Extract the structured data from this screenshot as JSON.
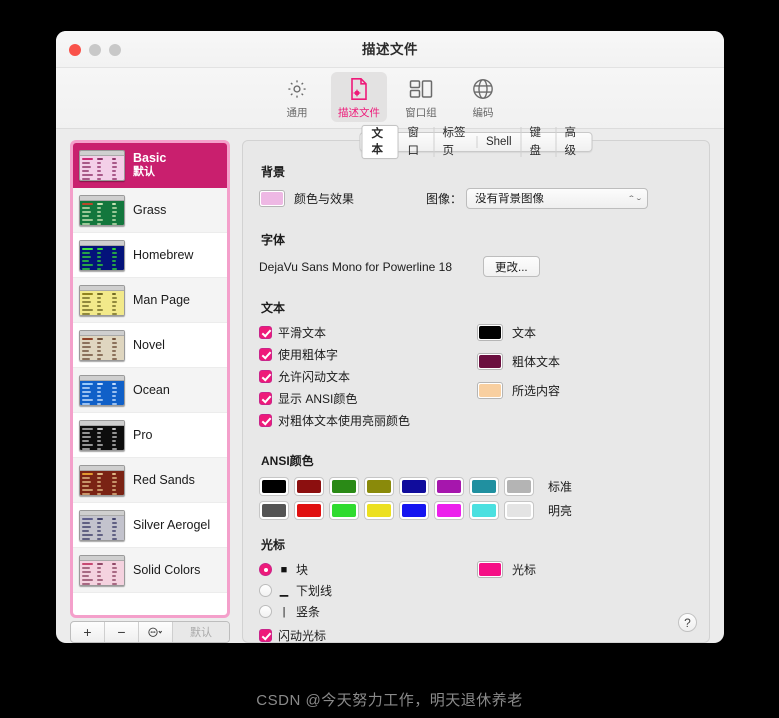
{
  "window": {
    "title": "描述文件"
  },
  "toolbar": {
    "items": [
      {
        "label": "通用",
        "icon": "gear-icon",
        "active": false
      },
      {
        "label": "描述文件",
        "icon": "profile-document-icon",
        "active": true
      },
      {
        "label": "窗口组",
        "icon": "window-group-icon",
        "active": false
      },
      {
        "label": "编码",
        "icon": "globe-icon",
        "active": false
      }
    ]
  },
  "sidebar": {
    "profiles": [
      {
        "name": "Basic",
        "subtitle": "默认",
        "selected": true,
        "thumb": {
          "bg": "#f3cfe8",
          "fg": "#8a2a63",
          "accent": "#c91f6e"
        }
      },
      {
        "name": "Grass",
        "subtitle": "",
        "selected": false,
        "thumb": {
          "bg": "#13773d",
          "fg": "#cfe8b8",
          "accent": "#c4442a"
        }
      },
      {
        "name": "Homebrew",
        "subtitle": "",
        "selected": false,
        "thumb": {
          "bg": "#04137a",
          "fg": "#33dd33",
          "accent": "#44ee44"
        }
      },
      {
        "name": "Man Page",
        "subtitle": "",
        "selected": false,
        "thumb": {
          "bg": "#f2e98a",
          "fg": "#6b6420",
          "accent": "#8a7c18"
        }
      },
      {
        "name": "Novel",
        "subtitle": "",
        "selected": false,
        "thumb": {
          "bg": "#dfd6c0",
          "fg": "#6b4a33",
          "accent": "#8a3a20"
        }
      },
      {
        "name": "Ocean",
        "subtitle": "",
        "selected": false,
        "thumb": {
          "bg": "#1060c8",
          "fg": "#cfe4ff",
          "accent": "#9fd0ff"
        }
      },
      {
        "name": "Pro",
        "subtitle": "",
        "selected": false,
        "thumb": {
          "bg": "#0d0d0d",
          "fg": "#c9c9c9",
          "accent": "#9a9a9a"
        }
      },
      {
        "name": "Red Sands",
        "subtitle": "",
        "selected": false,
        "thumb": {
          "bg": "#7a2314",
          "fg": "#e4c08a",
          "accent": "#e8a030"
        }
      },
      {
        "name": "Silver Aerogel",
        "subtitle": "",
        "selected": false,
        "thumb": {
          "bg": "#c3c3cd",
          "fg": "#3a3a66",
          "accent": "#5a5a88"
        }
      },
      {
        "name": "Solid Colors",
        "subtitle": "",
        "selected": false,
        "thumb": {
          "bg": "#f4d2df",
          "fg": "#8a4060",
          "accent": "#c4406a"
        }
      }
    ],
    "bottom_bar": {
      "add_label": "+",
      "remove_label": "−",
      "actions_label": "●",
      "default_label": "默认"
    }
  },
  "panel": {
    "tabs": [
      {
        "label": "文本",
        "active": true
      },
      {
        "label": "窗口",
        "active": false
      },
      {
        "label": "标签页",
        "active": false
      },
      {
        "label": "Shell",
        "active": false
      },
      {
        "label": "键盘",
        "active": false
      },
      {
        "label": "高级",
        "active": false
      }
    ],
    "background": {
      "heading": "背景",
      "color_label": "颜色与效果",
      "color": "#eeb8e4",
      "image_label": "图像：",
      "image_value": "没有背景图像",
      "image_options": [
        "没有背景图像"
      ]
    },
    "font": {
      "heading": "字体",
      "value": "DejaVu Sans Mono for Powerline 18",
      "change_label": "更改..."
    },
    "text": {
      "heading": "文本",
      "checkboxes": [
        {
          "label": "平滑文本",
          "checked": true
        },
        {
          "label": "使用粗体字",
          "checked": true
        },
        {
          "label": "允许闪动文本",
          "checked": true
        },
        {
          "label": "显示 ANSI颜色",
          "checked": true
        },
        {
          "label": "对粗体文本使用亮丽颜色",
          "checked": true
        }
      ],
      "swatches": [
        {
          "label": "文本",
          "color": "#000000"
        },
        {
          "label": "粗体文本",
          "color": "#6b0f3f"
        },
        {
          "label": "所选内容",
          "color": "#f8cfa0"
        }
      ]
    },
    "ansi": {
      "heading": "ANSI颜色",
      "normal_label": "标准",
      "bright_label": "明亮",
      "normal": [
        "#000000",
        "#8c0f0f",
        "#2a8a16",
        "#8a8a0a",
        "#100c9c",
        "#a616ad",
        "#2090a0",
        "#b4b4b4"
      ],
      "bright": [
        "#545454",
        "#e01010",
        "#2fdb2f",
        "#ece020",
        "#1414f0",
        "#ec20ec",
        "#4be0e0",
        "#e4e4e4"
      ]
    },
    "cursor": {
      "heading": "光标",
      "options": [
        {
          "label": "块",
          "glyph": "■",
          "selected": true
        },
        {
          "label": "下划线",
          "glyph": "▁",
          "selected": false
        },
        {
          "label": "竖条",
          "glyph": "|",
          "selected": false
        }
      ],
      "blink_label": "闪动光标",
      "blink_checked": true,
      "swatch_label": "光标",
      "swatch_color": "#f50f86"
    },
    "help_label": "?"
  },
  "watermark": "CSDN @今天努力工作，明天退休养老"
}
